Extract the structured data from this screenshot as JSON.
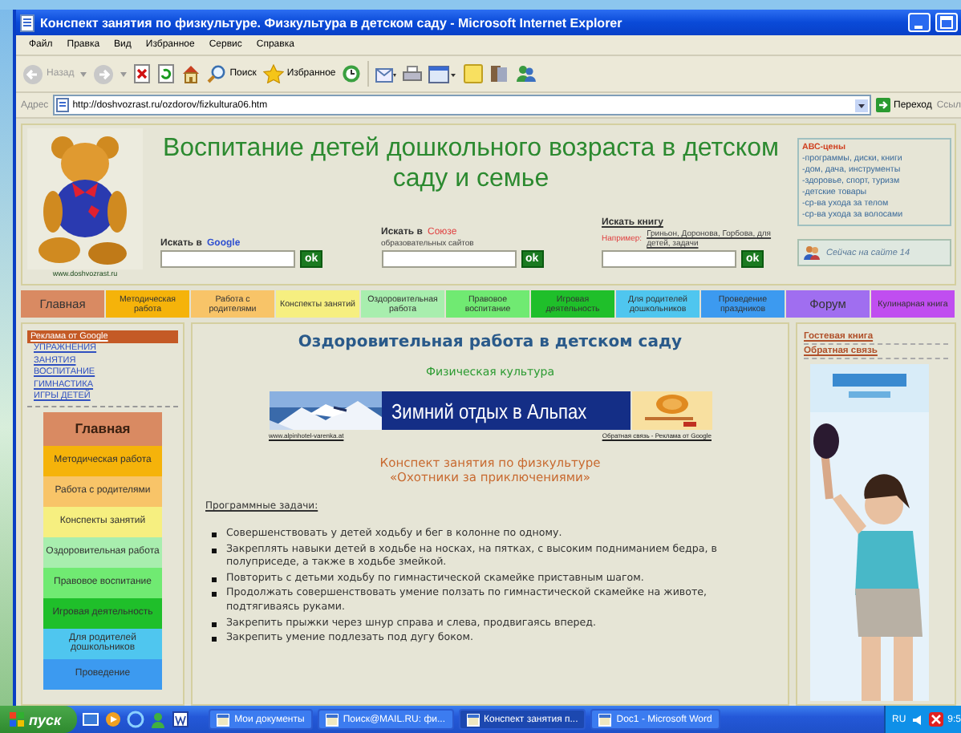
{
  "window": {
    "title": "Конспект занятия по физкультуре. Физкультура в детском саду - Microsoft Internet Explorer"
  },
  "menu": [
    "Файл",
    "Правка",
    "Вид",
    "Избранное",
    "Сервис",
    "Справка"
  ],
  "toolbar": {
    "back": "Назад",
    "search": "Поиск",
    "favorites": "Избранное"
  },
  "address": {
    "label": "Адрес",
    "value": "http://doshvozrast.ru/ozdorov/fizkultura06.htm",
    "go": "Переход",
    "links": "Ссыл"
  },
  "header": {
    "title": "Воспитание детей дошкольного возраста в детском саду и семье",
    "logo_caption": "www.doshvozrast.ru",
    "searches": [
      {
        "kind": "google",
        "label": "Искать в",
        "brand": "Google",
        "button": "ok"
      },
      {
        "kind": "union",
        "label": "Искать в",
        "brand": "Союзе",
        "note": "образовательных сайтов",
        "button": "ok"
      },
      {
        "kind": "book",
        "label": "Искать книгу",
        "prefix": "Например:",
        "note": "Гриньон, Доронова, Горбова, для детей, задачи",
        "button": "ok"
      }
    ],
    "prices": {
      "title": "АВС-цены",
      "items": [
        "-программы, диски, книги",
        "-дом, дача, инструменты",
        "-здоровье, спорт, туризм",
        "-детские товары",
        "-ср-ва ухода за телом",
        "-ср-ва ухода за волосами"
      ]
    },
    "online": "Сейчас на сайте 14"
  },
  "nav": [
    {
      "label": "Главная",
      "color": "#d98a62"
    },
    {
      "label": "Методическая работа",
      "color": "#f5b30a"
    },
    {
      "label": "Работа с родителями",
      "color": "#f8c468"
    },
    {
      "label": "Конспекты занятий",
      "color": "#f6ef80"
    },
    {
      "label": "Оздоровительная работа",
      "color": "#a8eeae"
    },
    {
      "label": "Правовое воспитание",
      "color": "#70ea72"
    },
    {
      "label": "Игровая деятельность",
      "color": "#1fbf2a"
    },
    {
      "label": "Для родителей дошкольников",
      "color": "#4fc6ef"
    },
    {
      "label": "Проведение праздников",
      "color": "#3c9af0"
    },
    {
      "label": "Форум",
      "color": "#a06ef0"
    },
    {
      "label": "Кулинарная книга",
      "color": "#c04ef0"
    }
  ],
  "sidebar": {
    "ads_title": "Реклама от Google",
    "ad_links": [
      "УПРАЖНЕНИЯ",
      "ЗАНЯТИЯ",
      "ВОСПИТАНИЕ",
      "ГИМНАСТИКА",
      "ИГРЫ ДЕТЕЙ"
    ],
    "menu": [
      {
        "label": "Главная",
        "color": "#d98a62"
      },
      {
        "label": "Методическая работа",
        "color": "#f5b30a"
      },
      {
        "label": "Работа с родителями",
        "color": "#f8c468"
      },
      {
        "label": "Конспекты занятий",
        "color": "#f6ef80"
      },
      {
        "label": "Оздоровительная работа",
        "color": "#a8eeae"
      },
      {
        "label": "Правовое воспитание",
        "color": "#70ea72"
      },
      {
        "label": "Игровая деятельность",
        "color": "#1fbf2a"
      },
      {
        "label": "Для родителей дошкольников",
        "color": "#4fc6ef"
      },
      {
        "label": "Проведение",
        "color": "#3c9af0"
      }
    ]
  },
  "main": {
    "heading": "Оздоровительная работа в детском саду",
    "subheading": "Физическая культура",
    "banner": {
      "text": "Зимний отдых в Альпах",
      "url": "www.alpinhotel-varenka.at",
      "ads_link": "Обратная связь - Реклама от Google"
    },
    "lesson_title": [
      "Конспект занятия по физкультуре",
      "«Охотники за приключениями»"
    ],
    "tasks_title": "Программные задачи:",
    "tasks": [
      "Совершенствовать у детей ходьбу и бег в колонне по одному.",
      "Закреплять навыки детей в ходьбе на носках, на пятках, с высоким подниманием бедра, в полуприседе, а также в ходьбе змейкой.",
      "Повторить с детьми ходьбу по гимнастической скамейке приставным шагом.",
      "Продолжать совершенствовать умение ползать по гимнастической скамейке на животе, подтягиваясь руками.",
      "Закрепить прыжки через шнур справа и слева, продвигаясь вперед.",
      "Закрепить умение подлезать под дугу боком."
    ]
  },
  "aside": {
    "links": [
      "Гостевая книга",
      "Обратная связь"
    ]
  },
  "taskbar": {
    "start": "пуск",
    "tasks": [
      {
        "label": "Мои документы",
        "selected": false
      },
      {
        "label": "Поиск@MAIL.RU: фи...",
        "selected": false
      },
      {
        "label": "Конспект занятия п...",
        "selected": true
      },
      {
        "label": "Doc1 - Microsoft Word",
        "selected": false
      }
    ],
    "lang": "RU",
    "clock": "9:5"
  }
}
